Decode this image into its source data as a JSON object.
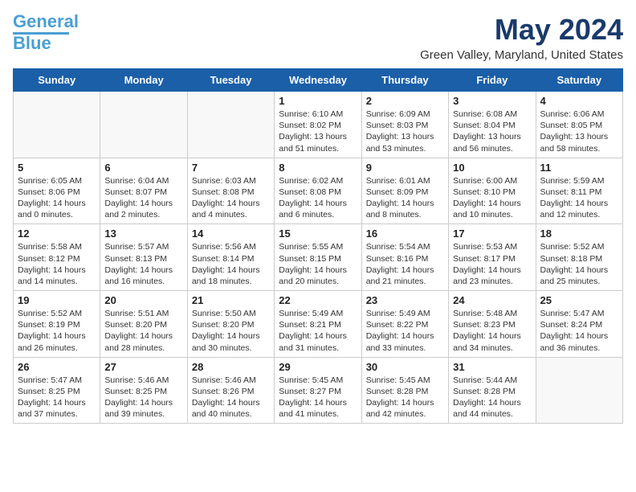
{
  "logo": {
    "line1": "General",
    "line2": "Blue"
  },
  "title": "May 2024",
  "location": "Green Valley, Maryland, United States",
  "days_of_week": [
    "Sunday",
    "Monday",
    "Tuesday",
    "Wednesday",
    "Thursday",
    "Friday",
    "Saturday"
  ],
  "weeks": [
    [
      {
        "day": "",
        "lines": []
      },
      {
        "day": "",
        "lines": []
      },
      {
        "day": "",
        "lines": []
      },
      {
        "day": "1",
        "lines": [
          "Sunrise: 6:10 AM",
          "Sunset: 8:02 PM",
          "Daylight: 13 hours",
          "and 51 minutes."
        ]
      },
      {
        "day": "2",
        "lines": [
          "Sunrise: 6:09 AM",
          "Sunset: 8:03 PM",
          "Daylight: 13 hours",
          "and 53 minutes."
        ]
      },
      {
        "day": "3",
        "lines": [
          "Sunrise: 6:08 AM",
          "Sunset: 8:04 PM",
          "Daylight: 13 hours",
          "and 56 minutes."
        ]
      },
      {
        "day": "4",
        "lines": [
          "Sunrise: 6:06 AM",
          "Sunset: 8:05 PM",
          "Daylight: 13 hours",
          "and 58 minutes."
        ]
      }
    ],
    [
      {
        "day": "5",
        "lines": [
          "Sunrise: 6:05 AM",
          "Sunset: 8:06 PM",
          "Daylight: 14 hours",
          "and 0 minutes."
        ]
      },
      {
        "day": "6",
        "lines": [
          "Sunrise: 6:04 AM",
          "Sunset: 8:07 PM",
          "Daylight: 14 hours",
          "and 2 minutes."
        ]
      },
      {
        "day": "7",
        "lines": [
          "Sunrise: 6:03 AM",
          "Sunset: 8:08 PM",
          "Daylight: 14 hours",
          "and 4 minutes."
        ]
      },
      {
        "day": "8",
        "lines": [
          "Sunrise: 6:02 AM",
          "Sunset: 8:08 PM",
          "Daylight: 14 hours",
          "and 6 minutes."
        ]
      },
      {
        "day": "9",
        "lines": [
          "Sunrise: 6:01 AM",
          "Sunset: 8:09 PM",
          "Daylight: 14 hours",
          "and 8 minutes."
        ]
      },
      {
        "day": "10",
        "lines": [
          "Sunrise: 6:00 AM",
          "Sunset: 8:10 PM",
          "Daylight: 14 hours",
          "and 10 minutes."
        ]
      },
      {
        "day": "11",
        "lines": [
          "Sunrise: 5:59 AM",
          "Sunset: 8:11 PM",
          "Daylight: 14 hours",
          "and 12 minutes."
        ]
      }
    ],
    [
      {
        "day": "12",
        "lines": [
          "Sunrise: 5:58 AM",
          "Sunset: 8:12 PM",
          "Daylight: 14 hours",
          "and 14 minutes."
        ]
      },
      {
        "day": "13",
        "lines": [
          "Sunrise: 5:57 AM",
          "Sunset: 8:13 PM",
          "Daylight: 14 hours",
          "and 16 minutes."
        ]
      },
      {
        "day": "14",
        "lines": [
          "Sunrise: 5:56 AM",
          "Sunset: 8:14 PM",
          "Daylight: 14 hours",
          "and 18 minutes."
        ]
      },
      {
        "day": "15",
        "lines": [
          "Sunrise: 5:55 AM",
          "Sunset: 8:15 PM",
          "Daylight: 14 hours",
          "and 20 minutes."
        ]
      },
      {
        "day": "16",
        "lines": [
          "Sunrise: 5:54 AM",
          "Sunset: 8:16 PM",
          "Daylight: 14 hours",
          "and 21 minutes."
        ]
      },
      {
        "day": "17",
        "lines": [
          "Sunrise: 5:53 AM",
          "Sunset: 8:17 PM",
          "Daylight: 14 hours",
          "and 23 minutes."
        ]
      },
      {
        "day": "18",
        "lines": [
          "Sunrise: 5:52 AM",
          "Sunset: 8:18 PM",
          "Daylight: 14 hours",
          "and 25 minutes."
        ]
      }
    ],
    [
      {
        "day": "19",
        "lines": [
          "Sunrise: 5:52 AM",
          "Sunset: 8:19 PM",
          "Daylight: 14 hours",
          "and 26 minutes."
        ]
      },
      {
        "day": "20",
        "lines": [
          "Sunrise: 5:51 AM",
          "Sunset: 8:20 PM",
          "Daylight: 14 hours",
          "and 28 minutes."
        ]
      },
      {
        "day": "21",
        "lines": [
          "Sunrise: 5:50 AM",
          "Sunset: 8:20 PM",
          "Daylight: 14 hours",
          "and 30 minutes."
        ]
      },
      {
        "day": "22",
        "lines": [
          "Sunrise: 5:49 AM",
          "Sunset: 8:21 PM",
          "Daylight: 14 hours",
          "and 31 minutes."
        ]
      },
      {
        "day": "23",
        "lines": [
          "Sunrise: 5:49 AM",
          "Sunset: 8:22 PM",
          "Daylight: 14 hours",
          "and 33 minutes."
        ]
      },
      {
        "day": "24",
        "lines": [
          "Sunrise: 5:48 AM",
          "Sunset: 8:23 PM",
          "Daylight: 14 hours",
          "and 34 minutes."
        ]
      },
      {
        "day": "25",
        "lines": [
          "Sunrise: 5:47 AM",
          "Sunset: 8:24 PM",
          "Daylight: 14 hours",
          "and 36 minutes."
        ]
      }
    ],
    [
      {
        "day": "26",
        "lines": [
          "Sunrise: 5:47 AM",
          "Sunset: 8:25 PM",
          "Daylight: 14 hours",
          "and 37 minutes."
        ]
      },
      {
        "day": "27",
        "lines": [
          "Sunrise: 5:46 AM",
          "Sunset: 8:25 PM",
          "Daylight: 14 hours",
          "and 39 minutes."
        ]
      },
      {
        "day": "28",
        "lines": [
          "Sunrise: 5:46 AM",
          "Sunset: 8:26 PM",
          "Daylight: 14 hours",
          "and 40 minutes."
        ]
      },
      {
        "day": "29",
        "lines": [
          "Sunrise: 5:45 AM",
          "Sunset: 8:27 PM",
          "Daylight: 14 hours",
          "and 41 minutes."
        ]
      },
      {
        "day": "30",
        "lines": [
          "Sunrise: 5:45 AM",
          "Sunset: 8:28 PM",
          "Daylight: 14 hours",
          "and 42 minutes."
        ]
      },
      {
        "day": "31",
        "lines": [
          "Sunrise: 5:44 AM",
          "Sunset: 8:28 PM",
          "Daylight: 14 hours",
          "and 44 minutes."
        ]
      },
      {
        "day": "",
        "lines": []
      }
    ]
  ]
}
